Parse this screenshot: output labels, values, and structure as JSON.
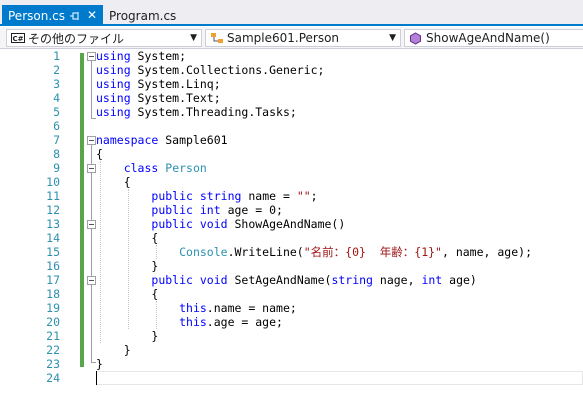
{
  "tabs": [
    {
      "label": "Person.cs",
      "active": true
    },
    {
      "label": "Program.cs",
      "active": false
    }
  ],
  "navbar": {
    "project": "その他のファイル",
    "class": "Sample601.Person",
    "member": "ShowAgeAndName()",
    "project_icon_text": "C#"
  },
  "colors": {
    "accent": "#007acc",
    "keyword": "#0000ff",
    "type": "#2b91af",
    "string": "#a31515",
    "change_bar": "#57a64a"
  },
  "line_numbers": [
    "1",
    "2",
    "3",
    "4",
    "5",
    "6",
    "7",
    "8",
    "9",
    "10",
    "11",
    "12",
    "13",
    "14",
    "15",
    "16",
    "17",
    "18",
    "19",
    "20",
    "21",
    "22",
    "23",
    "24"
  ],
  "code": {
    "l1": {
      "kw": "using",
      "rest": " System;"
    },
    "l2": {
      "kw": "using",
      "rest": " System.Collections.Generic;"
    },
    "l3": {
      "kw": "using",
      "rest": " System.Linq;"
    },
    "l4": {
      "kw": "using",
      "rest": " System.Text;"
    },
    "l5": {
      "kw": "using",
      "rest": " System.Threading.Tasks;"
    },
    "l7": {
      "kw": "namespace",
      "rest": " Sample601"
    },
    "l8": "{",
    "l9": {
      "indent": "    ",
      "kw": "class",
      "type": "Person"
    },
    "l10": "    {",
    "l11": {
      "indent": "        ",
      "kw1": "public",
      "kw2": "string",
      "mid": " name = ",
      "str": "\"\"",
      "end": ";"
    },
    "l12": {
      "indent": "        ",
      "kw1": "public",
      "kw2": "int",
      "rest": " age = 0;"
    },
    "l13": {
      "indent": "        ",
      "kw1": "public",
      "kw2": "void",
      "rest": " ShowAgeAndName()"
    },
    "l14": "        {",
    "l15": {
      "indent": "            ",
      "type": "Console",
      "mid": ".WriteLine(",
      "str": "\"名前：{0}  年齢：{1}\"",
      "end": ", name, age);"
    },
    "l16": "        }",
    "l17": {
      "indent": "        ",
      "kw1": "public",
      "kw2": "void",
      "mid": " SetAgeAndName(",
      "kw3": "string",
      "mid2": " nage, ",
      "kw4": "int",
      "end": " age)"
    },
    "l18": "        {",
    "l19": {
      "indent": "            ",
      "kw": "this",
      "rest": ".name = name;"
    },
    "l20": {
      "indent": "            ",
      "kw": "this",
      "rest": ".age = age;"
    },
    "l21": "        }",
    "l22": "    }",
    "l23": "}"
  }
}
